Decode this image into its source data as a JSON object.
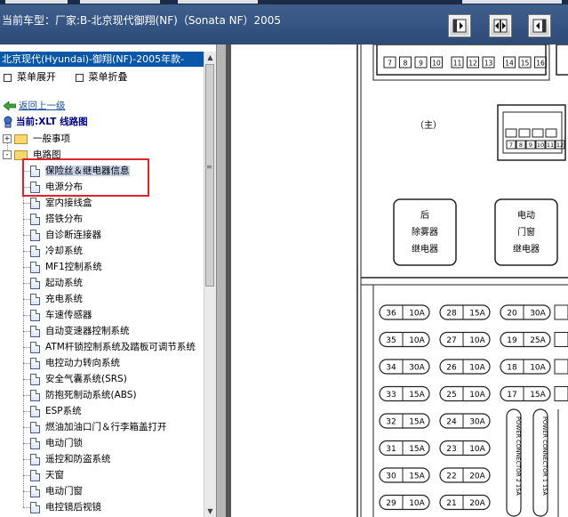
{
  "window": {
    "title": "当前车型：厂家:B-北京现代御翔(NF)（Sonata NF）2005",
    "toolbar_buttons": [
      {
        "name": "panel-left-button",
        "icon": "panel-left-icon"
      },
      {
        "name": "panel-split-button",
        "icon": "panel-split-icon"
      },
      {
        "name": "panel-right-button",
        "icon": "panel-right-icon"
      }
    ]
  },
  "sidebar": {
    "model_header": "北京现代(Hyundai)-御翔(NF)-2005年款-",
    "expand_label": "菜单展开",
    "collapse_label": "菜单折叠",
    "back_label": "返回上一级",
    "current_label": "当前:XLT 线路图",
    "tree": [
      {
        "label": "一般事项",
        "kind": "folder",
        "level": 0,
        "toggle": "+"
      },
      {
        "label": "电路图",
        "kind": "folder",
        "level": 0,
        "toggle": "-"
      },
      {
        "label": "保险丝＆继电器信息",
        "kind": "doc",
        "level": 1,
        "selected": true
      },
      {
        "label": "电源分布",
        "kind": "doc",
        "level": 1
      },
      {
        "label": "室内接线盒",
        "kind": "doc",
        "level": 1
      },
      {
        "label": "搭铁分布",
        "kind": "doc",
        "level": 1
      },
      {
        "label": "自诊断连接器",
        "kind": "doc",
        "level": 1
      },
      {
        "label": "冷却系统",
        "kind": "doc",
        "level": 1
      },
      {
        "label": "MF1控制系统",
        "kind": "doc",
        "level": 1
      },
      {
        "label": "起动系统",
        "kind": "doc",
        "level": 1
      },
      {
        "label": "充电系统",
        "kind": "doc",
        "level": 1
      },
      {
        "label": "车速传感器",
        "kind": "doc",
        "level": 1
      },
      {
        "label": "自动变速器控制系统",
        "kind": "doc",
        "level": 1
      },
      {
        "label": "ATM杆锁控制系统及踏板可调节系统",
        "kind": "doc",
        "level": 1
      },
      {
        "label": "电控动力转向系统",
        "kind": "doc",
        "level": 1
      },
      {
        "label": "安全气囊系统(SRS)",
        "kind": "doc",
        "level": 1
      },
      {
        "label": "防抱死制动系统(ABS)",
        "kind": "doc",
        "level": 1
      },
      {
        "label": "ESP系统",
        "kind": "doc",
        "level": 1
      },
      {
        "label": "燃油加油口门＆行李箱盖打开",
        "kind": "doc",
        "level": 1
      },
      {
        "label": "电动门锁",
        "kind": "doc",
        "level": 1
      },
      {
        "label": "遥控和防盗系统",
        "kind": "doc",
        "level": 1
      },
      {
        "label": "天窗",
        "kind": "doc",
        "level": 1
      },
      {
        "label": "电动门窗",
        "kind": "doc",
        "level": 1
      },
      {
        "label": "电控镜后视镜",
        "kind": "doc",
        "level": 1
      }
    ]
  },
  "diagram": {
    "connector_top_numbers_left": [
      "7",
      "8",
      "9",
      "10",
      "11",
      "12",
      "13",
      "14",
      "15",
      "16"
    ],
    "main_label": "（主）",
    "connector_right_numbers": [
      "7",
      "8",
      "9",
      "10",
      "11",
      "12"
    ],
    "relays": [
      {
        "lines": [
          "后",
          "除雾器",
          "继电器"
        ]
      },
      {
        "lines": [
          "电动",
          "门窗",
          "继电器"
        ]
      }
    ],
    "fuses_left": [
      {
        "num": "36",
        "amp": "10A"
      },
      {
        "num": "35",
        "amp": "10A"
      },
      {
        "num": "34",
        "amp": "30A"
      },
      {
        "num": "33",
        "amp": "15A"
      },
      {
        "num": "32",
        "amp": "15A"
      },
      {
        "num": "31",
        "amp": "15A"
      },
      {
        "num": "30",
        "amp": "15A"
      },
      {
        "num": "29",
        "amp": "10A"
      }
    ],
    "fuses_mid": [
      {
        "num": "28",
        "amp": "15A"
      },
      {
        "num": "27",
        "amp": "10A"
      },
      {
        "num": "26",
        "amp": "10A"
      },
      {
        "num": "25",
        "amp": "10A"
      },
      {
        "num": "24",
        "amp": "30A"
      },
      {
        "num": "23",
        "amp": "10A"
      },
      {
        "num": "22",
        "amp": "20A"
      },
      {
        "num": "21",
        "amp": "20A"
      }
    ],
    "fuses_right": [
      {
        "num": "20",
        "amp": "30A"
      },
      {
        "num": "19",
        "amp": "25A"
      },
      {
        "num": "18",
        "amp": "10A"
      },
      {
        "num": "17",
        "amp": "15A"
      }
    ],
    "power_connectors": [
      "POWER CONNECTOR 2 15A",
      "POWER CONNECTOR 1 15A"
    ]
  }
}
